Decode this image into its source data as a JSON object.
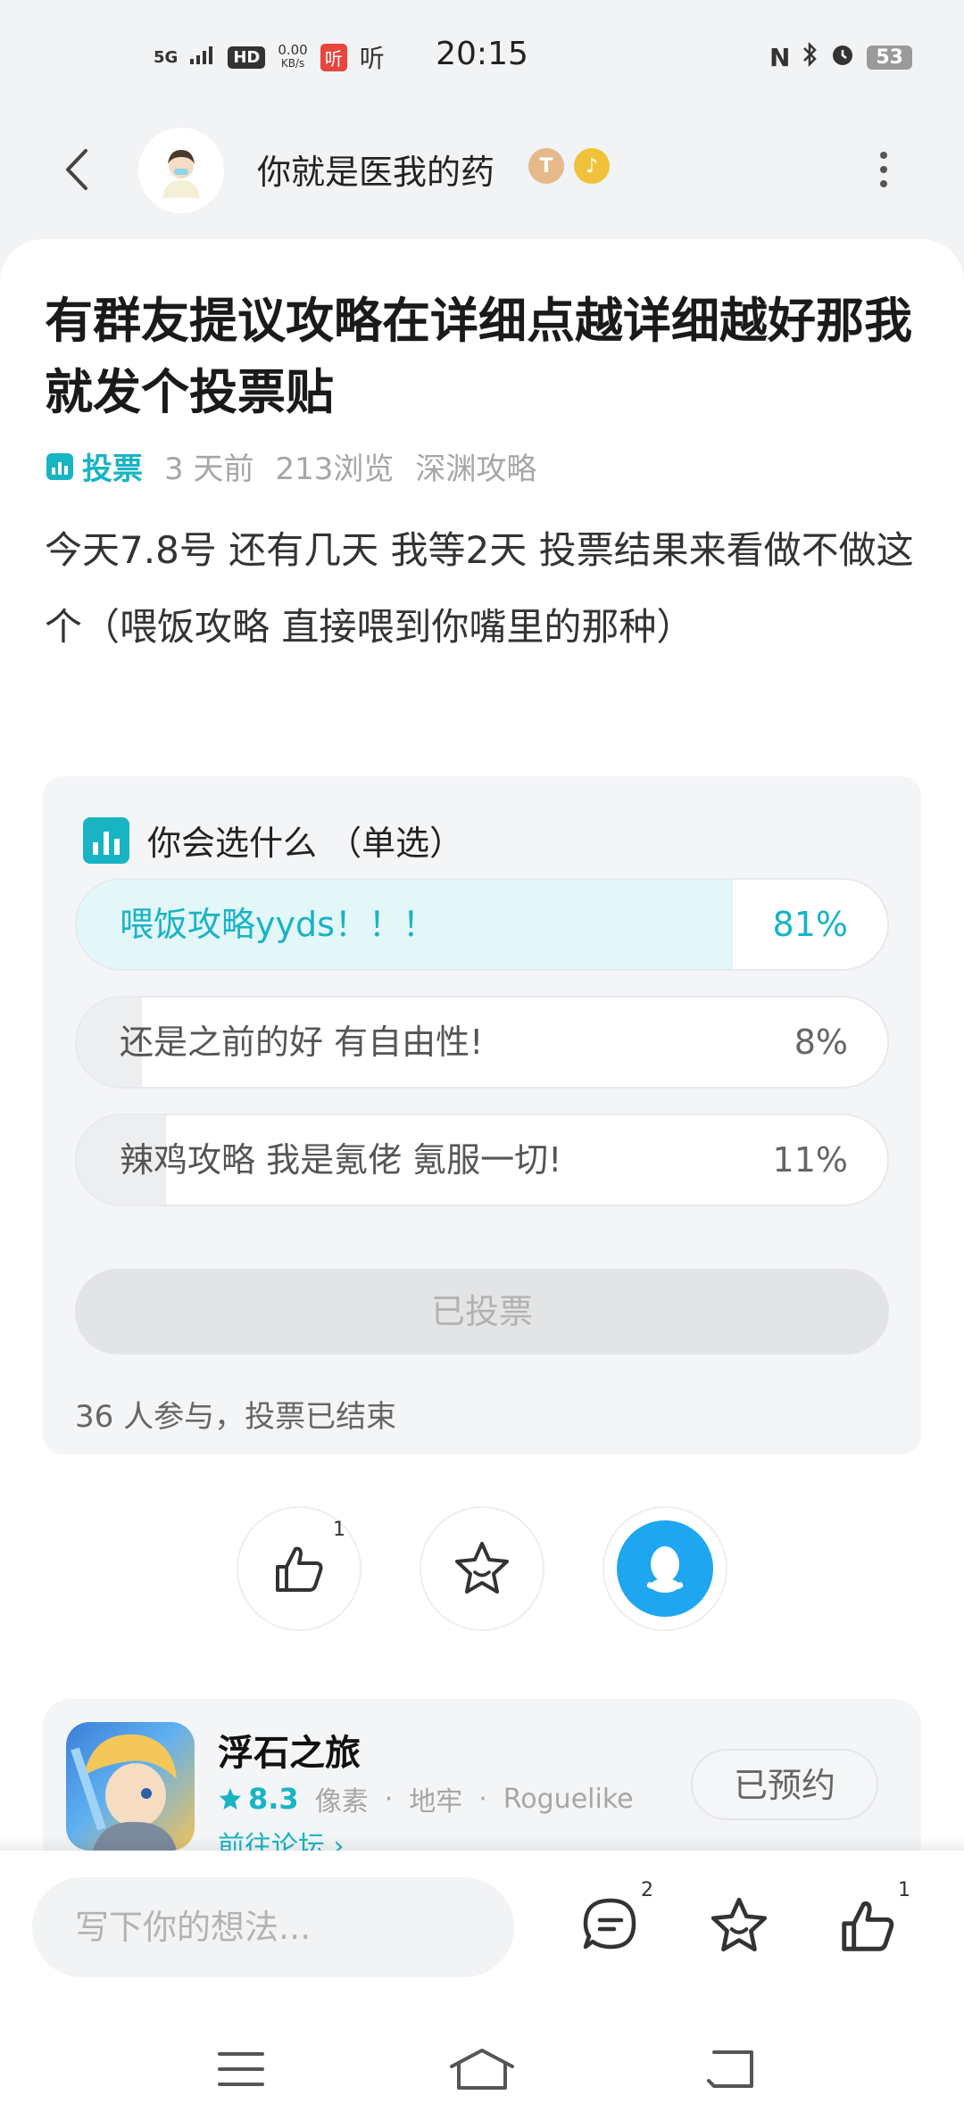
{
  "status_bar": {
    "network": "5G",
    "hd": "HD",
    "speed_value": "0.00",
    "speed_unit": "KB/s",
    "app1": "听",
    "app2": "听",
    "time": "20:15",
    "nfc": "N",
    "battery": "53"
  },
  "header": {
    "author": "你就是医我的药",
    "badge_t": "T",
    "badge_g": "♪"
  },
  "post": {
    "title": "有群友提议攻略在详细点越详细越好那我就发个投票贴",
    "tag": "投票",
    "time_ago": "3 天前",
    "views": "213浏览",
    "forum": "深渊攻略",
    "body": "今天7.8号 还有几天  我等2天 投票结果来看做不做这个（喂饭攻略 直接喂到你嘴里的那种）"
  },
  "poll": {
    "question": "你会选什么 （单选）",
    "options": [
      {
        "label": "喂饭攻略yyds！！！",
        "percent": "81%",
        "ratio": 0.81,
        "selected": true
      },
      {
        "label": "还是之前的好 有自由性!",
        "percent": "8%",
        "ratio": 0.08,
        "selected": false
      },
      {
        "label": "辣鸡攻略 我是氪佬 氪服一切!",
        "percent": "11%",
        "ratio": 0.11,
        "selected": false
      }
    ],
    "voted_label": "已投票",
    "footer": "36 人参与，投票已结束"
  },
  "actions": {
    "like_count": "1"
  },
  "game": {
    "name": "浮石之旅",
    "score": "8.3",
    "tags": [
      "像素",
      "·",
      "地牢",
      "·",
      "Roguelike"
    ],
    "forum_link": "前往论坛 ›",
    "reserve": "已预约"
  },
  "bottom": {
    "placeholder": "写下你的想法...",
    "comment_count": "2",
    "like_count": "1"
  },
  "colors": {
    "accent": "#18b4c4",
    "qq": "#1ea6f0"
  }
}
